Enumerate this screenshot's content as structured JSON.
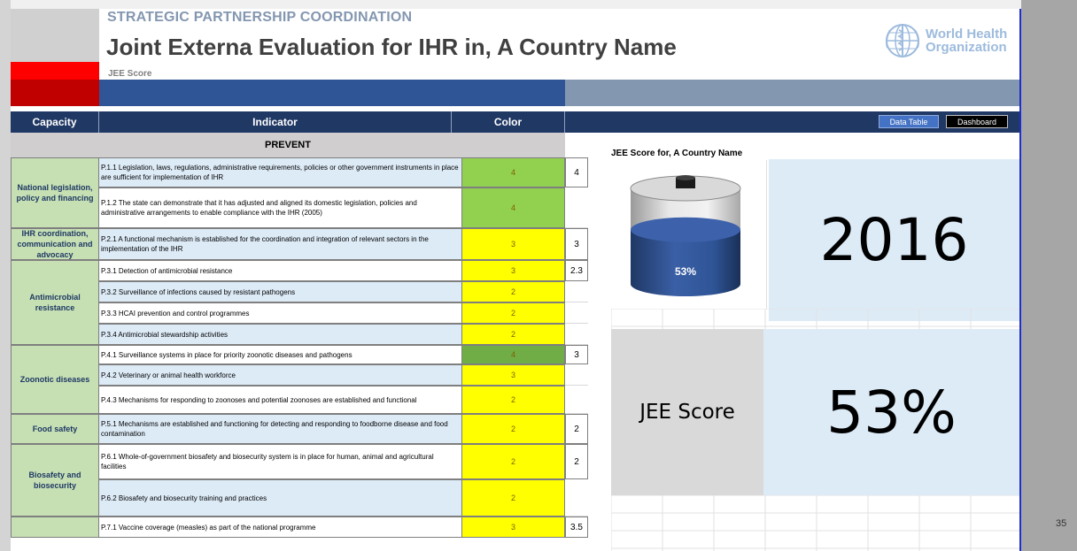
{
  "header": {
    "subtitle": "STRATEGIC PARTNERSHIP COORDINATION",
    "title": "Joint Externa Evaluation for IHR in, A Country Name",
    "score_label": "JEE Score",
    "org_name_line1": "World Health",
    "org_name_line2": "Organization"
  },
  "columns": {
    "capacity": "Capacity",
    "indicator": "Indicator",
    "color": "Color"
  },
  "nav": {
    "data_table": "Data Table",
    "dashboard": "Dashboard"
  },
  "section": {
    "prevent": "PREVENT"
  },
  "capacities": [
    {
      "label": "National legislation, policy and financing"
    },
    {
      "label": "IHR coordination, communication and advocacy"
    },
    {
      "label": "Antimicrobial resistance"
    },
    {
      "label": "Zoonotic diseases"
    },
    {
      "label": "Food safety"
    },
    {
      "label": "Biosafety and biosecurity"
    },
    {
      "label": ""
    }
  ],
  "indicators": [
    {
      "text": "P.1.1 Legislation, laws, regulations, administrative requirements, policies or other government instruments in place are sufficient for implementation of IHR",
      "color_value": "4",
      "color_hex": "#92d050",
      "score": "4"
    },
    {
      "text": "P.1.2 The state can demonstrate that it has adjusted and aligned its domestic legislation, policies and administrative arrangements to enable compliance with the IHR (2005)",
      "color_value": "4",
      "color_hex": "#92d050",
      "score": ""
    },
    {
      "text": "P.2.1 A functional mechanism is established for the coordination and integration of relevant sectors in the implementation of the IHR",
      "color_value": "3",
      "color_hex": "#ffff00",
      "score": "3"
    },
    {
      "text": "P.3.1 Detection of antimicrobial resistance",
      "color_value": "3",
      "color_hex": "#ffff00",
      "score": "2.3"
    },
    {
      "text": "P.3.2 Surveillance of infections caused by resistant pathogens",
      "color_value": "2",
      "color_hex": "#ffff00",
      "score": ""
    },
    {
      "text": "P.3.3 HCAI prevention and control programmes",
      "color_value": "2",
      "color_hex": "#ffff00",
      "score": ""
    },
    {
      "text": "P.3.4 Antimicrobial stewardship activities",
      "color_value": "2",
      "color_hex": "#ffff00",
      "score": ""
    },
    {
      "text": "P.4.1 Surveillance systems in place for priority zoonotic diseases and pathogens",
      "color_value": "4",
      "color_hex": "#70ad47",
      "score": "3"
    },
    {
      "text": "P.4.2 Veterinary or animal health workforce",
      "color_value": "3",
      "color_hex": "#ffff00",
      "score": ""
    },
    {
      "text": "P.4.3 Mechanisms for responding to zoonoses and potential zoonoses are established and functional",
      "color_value": "2",
      "color_hex": "#ffff00",
      "score": ""
    },
    {
      "text": "P.5.1 Mechanisms are established and functioning for detecting and responding to foodborne disease and food contamination",
      "color_value": "2",
      "color_hex": "#ffff00",
      "score": "2"
    },
    {
      "text": "P.6.1 Whole-of-government biosafety and biosecurity system is in place for human, animal and agricultural facilities",
      "color_value": "2",
      "color_hex": "#ffff00",
      "score": "2"
    },
    {
      "text": "P.6.2 Biosafety and biosecurity training and practices",
      "color_value": "2",
      "color_hex": "#ffff00",
      "score": ""
    },
    {
      "text": "P.7.1 Vaccine coverage (measles) as part of the national programme",
      "color_value": "3",
      "color_hex": "#ffff00",
      "score": "3.5"
    }
  ],
  "dashboard": {
    "chart_title": "JEE Score for, A Country Name",
    "cylinder_label": "53%",
    "cylinder_fill_fraction": 0.53,
    "year": "2016",
    "score_caption": "JEE Score",
    "score_value": "53%"
  },
  "sheet": {
    "page_number": "35"
  },
  "colors": {
    "red": "#ff0000",
    "dark_red": "#c00000",
    "navy": "#203864",
    "blue_band": "#2f5597",
    "slate": "#8497b0",
    "capacity_green": "#c6e0b4",
    "light_blue": "#ddebf7",
    "cylinder_blue": "#2f5597"
  }
}
